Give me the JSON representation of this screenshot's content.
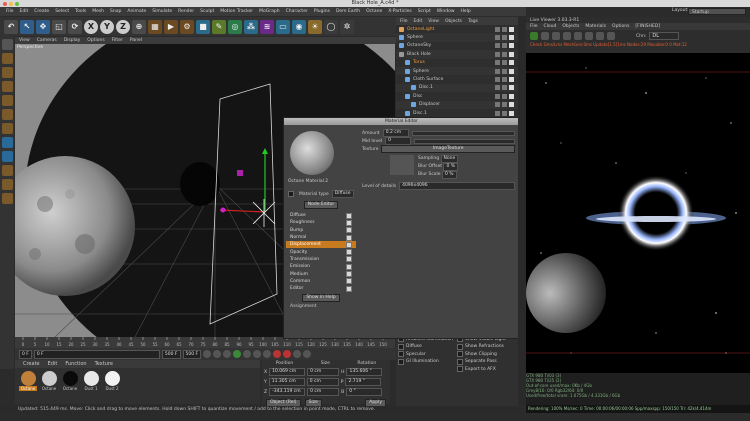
{
  "window_title": "Black Hole_A.c4d *",
  "menubar": [
    "File",
    "Edit",
    "Create",
    "Select",
    "Tools",
    "Mesh",
    "Snap",
    "Animate",
    "Simulate",
    "Render",
    "Sculpt",
    "Motion Tracker",
    "MoGraph",
    "Character",
    "Plugins",
    "Dem Earth",
    "Octane",
    "X-Particles",
    "Script",
    "Window",
    "Help"
  ],
  "layout": {
    "label": "Layout:",
    "value": "Startup"
  },
  "toolbar": {
    "x": "X",
    "y": "Y",
    "z": "Z"
  },
  "viewport": {
    "menu": [
      "View",
      "Cameras",
      "Display",
      "Options",
      "Filter",
      "Panel"
    ],
    "label": "Perspective"
  },
  "object_manager": {
    "menu": [
      "File",
      "Edit",
      "View",
      "Objects",
      "Tags"
    ],
    "rows": [
      {
        "label": "OctaneLight",
        "color": "#e0a060",
        "indent": 0,
        "highlight": true
      },
      {
        "label": "Sphere",
        "color": "#6fa6e0",
        "indent": 0
      },
      {
        "label": "OctaneSky",
        "color": "#6fa6e0",
        "indent": 0
      },
      {
        "label": "Black Hole",
        "color": "#9a9a9a",
        "indent": 0
      },
      {
        "label": "Torus",
        "color": "#6fa6e0",
        "indent": 1,
        "highlight": true
      },
      {
        "label": "Sphere",
        "color": "#6fa6e0",
        "indent": 1
      },
      {
        "label": "Cloth Surface",
        "color": "#6fa6e0",
        "indent": 1
      },
      {
        "label": "Disc.1",
        "color": "#6fa6e0",
        "indent": 2
      },
      {
        "label": "Disc",
        "color": "#6fa6e0",
        "indent": 1
      },
      {
        "label": "Displacer",
        "color": "#6fa6e0",
        "indent": 2
      },
      {
        "label": "Disc.1",
        "color": "#6fa6e0",
        "indent": 1
      }
    ]
  },
  "material_editor": {
    "title": "Material Editor",
    "material_name": "Octane Material.2",
    "material_type_label": "Material type",
    "material_type_value": "Diffuse",
    "node_editor": "Node Editor",
    "channels": [
      "Diffuse",
      "Roughness",
      "Bump",
      "Normal",
      "Displacement",
      "Opacity",
      "Transmission",
      "Emission",
      "Medium",
      "Common",
      "Editor"
    ],
    "active_channel": "Displacement",
    "show_in_help": "Show in Help",
    "assignment": "Assignment",
    "amount_label": "Amount",
    "amount_value": "0.2 cm",
    "mid_level_label": "Mid level",
    "mid_level_value": "0",
    "texture_label": "Texture",
    "texture_button": "ImageTexture",
    "sampling_label": "Sampling",
    "sampling_value": "None",
    "blur_offset_label": "Blur Offset",
    "blur_offset_value": "0 %",
    "blur_scale_label": "Blur Scale",
    "blur_scale_value": "0 %",
    "level_of_details_label": "Level of details",
    "level_of_details_value": "4096x4096"
  },
  "timeline": {
    "ticks": [
      "0",
      "5",
      "10",
      "15",
      "20",
      "25",
      "30",
      "35",
      "40",
      "45",
      "50",
      "55",
      "60",
      "65",
      "70",
      "75",
      "80",
      "85",
      "90",
      "95",
      "100",
      "105",
      "110",
      "115",
      "120",
      "125",
      "130",
      "135",
      "140",
      "145",
      "150"
    ],
    "current_frame": "0 F",
    "start": "0 F",
    "end": "500 F",
    "max": "500 F",
    "out": "150 F"
  },
  "material_manager": {
    "menu": [
      "Create",
      "Edit",
      "Function",
      "Texture"
    ],
    "materials": [
      "Octane",
      "Octane",
      "Octane",
      "Dust 1",
      "Dust 2"
    ]
  },
  "coordinates": {
    "headers": [
      "Position",
      "Size",
      "Rotation"
    ],
    "rows": [
      {
        "axis": "X",
        "pos": "10.069 cm",
        "size": "0 cm",
        "rot_axis": "H",
        "rot": "135.606 °"
      },
      {
        "axis": "Y",
        "pos": "11.305 cm",
        "size": "0 cm",
        "rot_axis": "P",
        "rot": "2.719 °"
      },
      {
        "axis": "Z",
        "pos": "-343.119 cm",
        "size": "0 cm",
        "rot_axis": "B",
        "rot": "0 °"
      }
    ],
    "mode": "Object (Rel)",
    "size_mode": "Size",
    "apply": "Apply"
  },
  "attributes": {
    "left": [
      "GI Illumination",
      "Ambient Illumination",
      "Diffuse",
      "Specular",
      "GI Illumination"
    ],
    "right": [
      "Show Illumination",
      "Show Visible Light",
      "Show Refractions",
      "Show Clipping",
      "Separate Pass",
      "Export to AFX"
    ]
  },
  "status": "Updated: 515.449 ms.    Move: Click and drag to move elements. Hold down SHIFT to quantize movement / add to the selection in point mode, CTRL to remove.",
  "live_viewer": {
    "title": "Live Viewer 3.03.3-R1",
    "menu": [
      "File",
      "Cloud",
      "Objects",
      "Materials",
      "Options",
      "[FINISHED]"
    ],
    "channel_label": "Chn:",
    "channel_value": "DL",
    "info": "Check Gms/Lms  MeshGen:0ms  Update[1.5]1ms  Nodes:29 Movable:0  0 Mot:12",
    "gpu_1": "GTX 980 Ti/03 (3)",
    "gpu_2": "GTX 980 Ti/25 (2)",
    "out_of_core": "Out-of-core used/max: 0Kb / 4Gb",
    "grey": "Grey8/16: 0/0",
    "rgb": "Rgb32/64: 0/0",
    "used": "Used/free/total vram: 1.075Gb / 4.331Gb / 6Gb",
    "bottom": "Rendering: 100%   Ms/sec: 0   Time: 00:00:06/00:00:06   Spp/maxspp: 150/150   Tri: 42k/4.414m"
  }
}
